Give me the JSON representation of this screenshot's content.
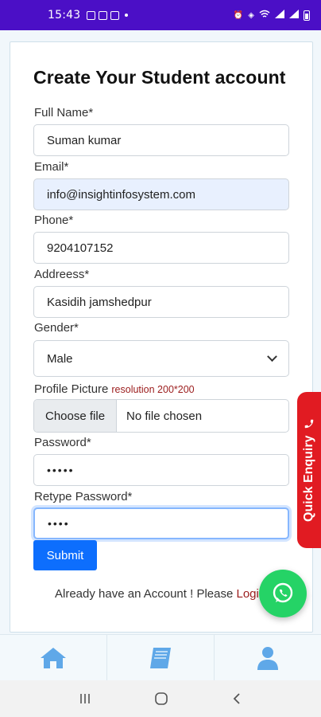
{
  "status_bar": {
    "time": "15:43",
    "icons": [
      "image-icon",
      "camera-icon",
      "gallery-icon",
      "notification-dot-icon",
      "alarm-icon",
      "vibrate-icon",
      "wifi-icon",
      "signal-icon",
      "battery-icon"
    ]
  },
  "form": {
    "title": "Create Your Student account",
    "full_name": {
      "label": "Full Name*",
      "value": "Suman kumar"
    },
    "email": {
      "label": "Email*",
      "value": "info@insightinfosystem.com"
    },
    "phone": {
      "label": "Phone*",
      "value": "9204107152"
    },
    "address": {
      "label": "Addreess*",
      "value": "Kasidih jamshedpur"
    },
    "gender": {
      "label": "Gender*",
      "value": "Male"
    },
    "profile_picture": {
      "label": "Profile Picture",
      "note": "resolution 200*200",
      "button": "Choose file",
      "status": "No file chosen"
    },
    "password": {
      "label": "Password*",
      "value": "•••••"
    },
    "retype_password": {
      "label": "Retype Password*",
      "value": "••••"
    },
    "submit_label": "Submit",
    "login_prompt": "Already have an Account ! Please ",
    "login_link": "Logi"
  },
  "quick_enquiry": {
    "label": "Quick Enquiry"
  },
  "tabs": [
    {
      "icon": "home-icon"
    },
    {
      "icon": "book-icon"
    },
    {
      "icon": "user-icon"
    }
  ],
  "colors": {
    "status_bar": "#4b0fc6",
    "primary": "#0d6efd",
    "enquiry": "#e11b22",
    "whatsapp": "#25d366",
    "link": "#9b1c1c",
    "tab_icon": "#5fa8e8"
  }
}
